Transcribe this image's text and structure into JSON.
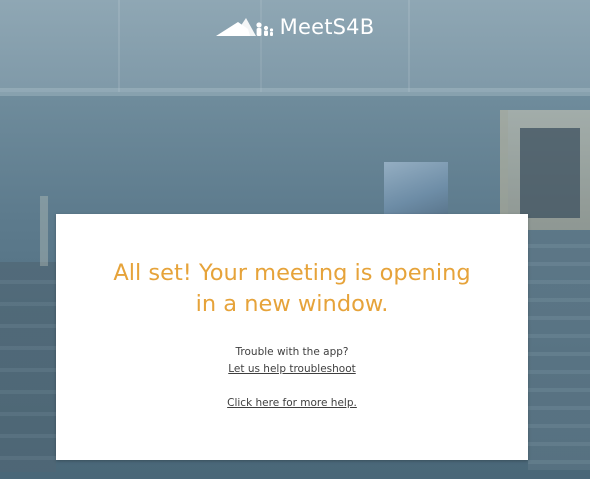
{
  "brand": {
    "name": "MeetS4B",
    "logo_icon": "mountain-people-logo-icon"
  },
  "card": {
    "headline_line1": "All set! Your meeting is opening",
    "headline_line2": "in a new window.",
    "trouble_text": "Trouble with the app?",
    "troubleshoot_link": "Let us help troubleshoot",
    "more_help_link": "Click here for more help."
  },
  "colors": {
    "accent_orange": "#e6a33a",
    "card_background": "#ffffff",
    "backdrop_tint": "#5d7b8d",
    "body_text": "#3f3f3f"
  }
}
